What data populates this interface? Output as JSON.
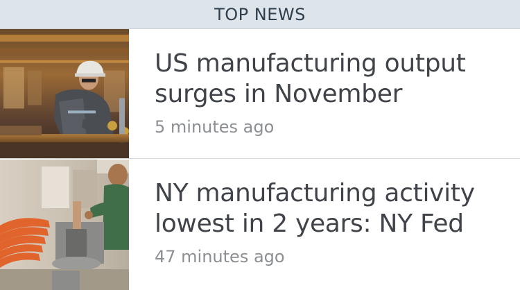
{
  "header": {
    "title": "TOP NEWS"
  },
  "articles": [
    {
      "headline": "US manufacturing output surges in November",
      "timestamp": "5 minutes ago",
      "thumbnail_icon": "factory-worker-photo"
    },
    {
      "headline": "NY manufacturing activity lowest in 2 years: NY Fed",
      "timestamp": "47 minutes ago",
      "thumbnail_icon": "workshop-worker-photo"
    }
  ]
}
